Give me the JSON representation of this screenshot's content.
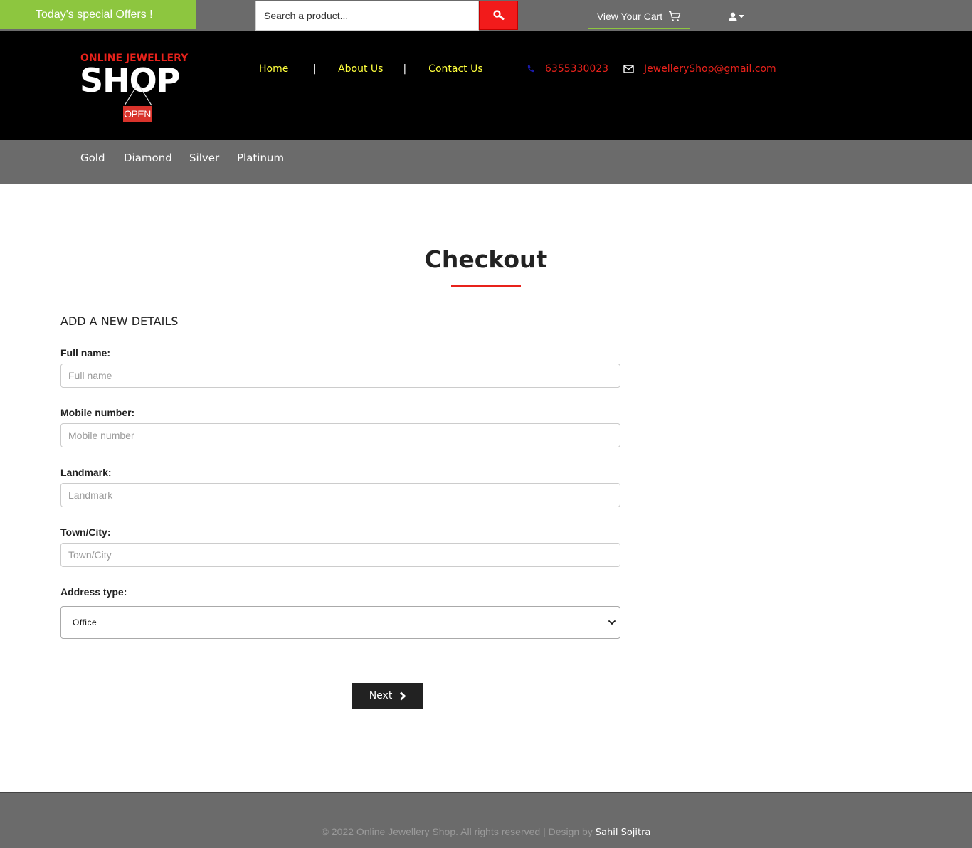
{
  "topbar": {
    "offers_label": "Today's special Offers !",
    "search_placeholder": "Search a product...",
    "cart_label": "View Your Cart"
  },
  "header": {
    "logo_top": "ONLINE JEWELLERY",
    "logo_main": "SHOP",
    "logo_sign": "OPEN",
    "nav": [
      "Home",
      "About Us",
      "Contact Us"
    ],
    "nav_separator": "|",
    "phone": "6355330023",
    "email": "JewelleryShop@gmail.com"
  },
  "categories": [
    "Gold",
    "Diamond",
    "Silver",
    "Platinum"
  ],
  "main": {
    "title": "Checkout",
    "section_heading": "ADD A NEW DETAILS",
    "fields": [
      {
        "label": "Full name:",
        "placeholder": "Full name"
      },
      {
        "label": "Mobile number:",
        "placeholder": "Mobile number"
      },
      {
        "label": "Landmark:",
        "placeholder": "Landmark"
      },
      {
        "label": "Town/City:",
        "placeholder": "Town/City"
      }
    ],
    "address_type_label": "Address type:",
    "address_type_value": "Office",
    "next_label": "Next"
  },
  "footer": {
    "text": "© 2022 Online Jewellery Shop. All rights reserved | Design by",
    "author": "Sahil Sojitra"
  },
  "colors": {
    "accent_red": "#e8221b",
    "offer_green": "#8dc63f",
    "nav_yellow": "#ffff3c",
    "bar_gray": "#6b6b6b"
  }
}
